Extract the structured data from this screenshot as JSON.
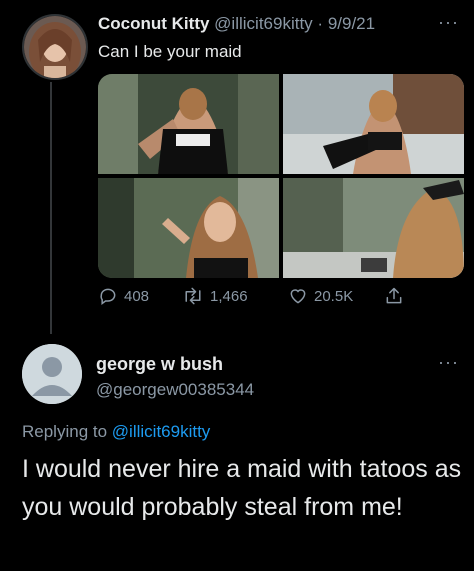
{
  "original_tweet": {
    "display_name": "Coconut Kitty",
    "handle": "@illicit69kitty",
    "separator": "·",
    "date": "9/9/21",
    "more": "···",
    "text": "Can I be your maid",
    "media_count": 4,
    "actions": {
      "replies": "408",
      "retweets": "1,466",
      "likes": "20.5K"
    }
  },
  "reply": {
    "display_name": "george w bush",
    "handle": "@georgew00385344",
    "more": "···",
    "replying_prefix": "Replying to",
    "replying_mention": "@illicit69kitty",
    "text": "I would never hire a maid with tatoos as you would probably steal from me!"
  },
  "colors": {
    "background": "#000000",
    "primary_text": "#e7e9ea",
    "secondary_text": "#8b98a5",
    "link": "#1d9bf0",
    "default_avatar_bg": "#cfd9de"
  },
  "icons": [
    "reply-icon",
    "retweet-icon",
    "like-icon",
    "share-icon",
    "more-icon"
  ]
}
